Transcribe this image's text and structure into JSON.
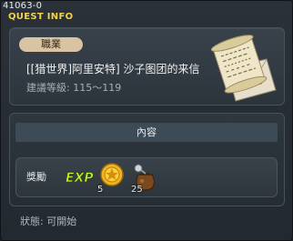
{
  "window": {
    "quest_id": "41063-0",
    "title": "QUEST INFO"
  },
  "info": {
    "job_badge": "職業",
    "quest_name": "[[猎世界]阿里安特] 沙子图团的来信",
    "level_req": "建議等級: 115～119",
    "illustration_icon": "letter-scroll-icon"
  },
  "content": {
    "header": "內容",
    "reward_label": "獎勵",
    "rewards": [
      {
        "icon": "exp-icon",
        "label": "EXP"
      },
      {
        "icon": "gold-coin-icon",
        "quantity": "5"
      },
      {
        "icon": "pouch-icon",
        "quantity": "25"
      }
    ]
  },
  "status": {
    "text": "狀態: 可開始"
  },
  "colors": {
    "title": "#f4d24a",
    "exp_text": "#c6f23a",
    "badge": "#d8c3a2"
  }
}
